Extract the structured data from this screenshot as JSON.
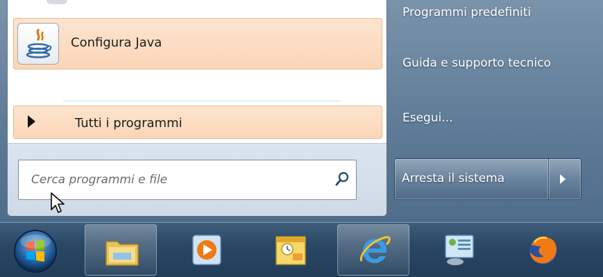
{
  "start_menu": {
    "pinned_item": {
      "label": "Configura Java",
      "icon": "java-icon"
    },
    "all_programs": {
      "label": "Tutti i programmi",
      "icon": "arrow-right-icon"
    },
    "search": {
      "placeholder": "Cerca programmi e file",
      "icon": "search-icon"
    },
    "right_pane": {
      "items": [
        {
          "label": "Programmi predefiniti"
        },
        {
          "label": "Guida e supporto tecnico"
        },
        {
          "label": "Esegui..."
        }
      ],
      "shutdown": {
        "label": "Arresta il sistema",
        "options_icon": "chevron-right-icon"
      }
    }
  },
  "taskbar": {
    "start_icon": "windows-orb-icon",
    "buttons": [
      {
        "icon": "file-explorer-icon",
        "active": true
      },
      {
        "icon": "media-player-icon",
        "active": false
      },
      {
        "icon": "outlook-calendar-icon",
        "active": false
      },
      {
        "icon": "internet-explorer-icon",
        "active": true
      },
      {
        "icon": "control-panel-icon",
        "active": false
      },
      {
        "icon": "firefox-icon",
        "active": false
      }
    ]
  },
  "colors": {
    "highlight": "#fbd6b8",
    "highlight_border": "#e9b88f",
    "taskbar": "#2a4866"
  }
}
